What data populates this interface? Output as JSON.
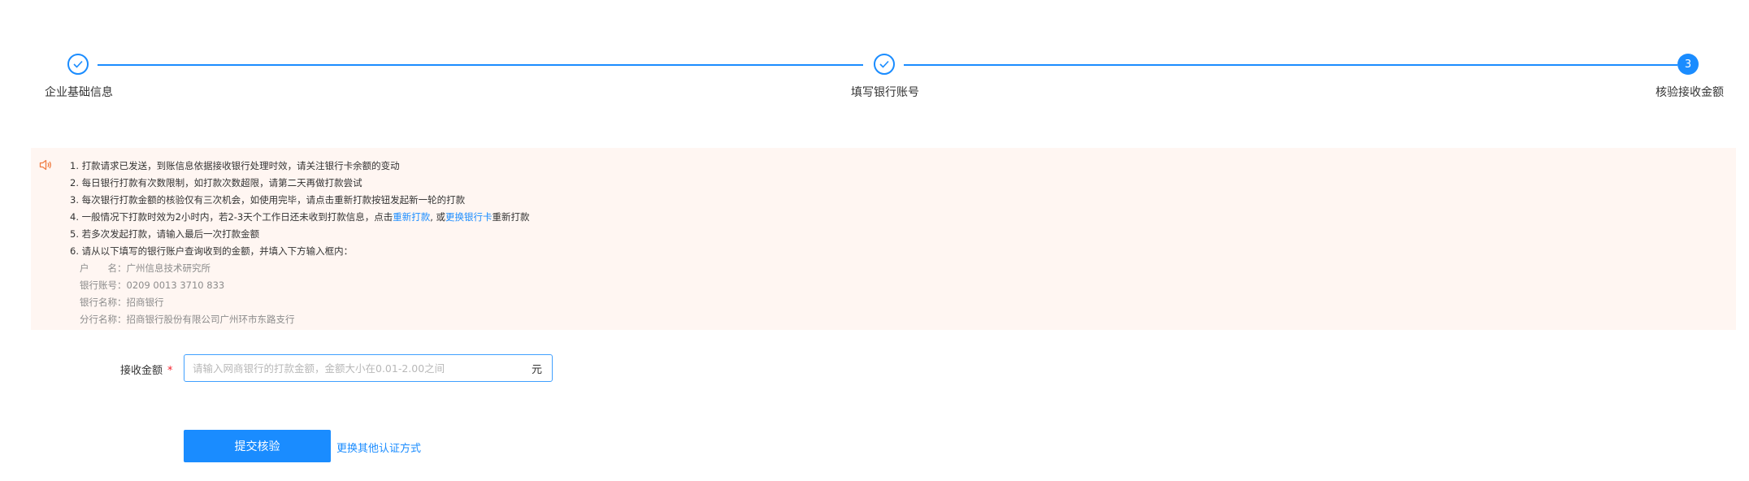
{
  "steps": [
    {
      "label": "企业基础信息",
      "status": "done"
    },
    {
      "label": "填写银行账号",
      "status": "done"
    },
    {
      "label": "核验接收金额",
      "status": "active",
      "number": "3"
    }
  ],
  "notice": {
    "icon": "speaker-icon",
    "items": [
      "1. 打款请求已发送，到账信息依据接收银行处理时效，请关注银行卡余额的变动",
      "2. 每日银行打款有次数限制，如打款次数超限，请第二天再做打款尝试",
      "3. 每次银行打款金额的核验仅有三次机会，如使用完毕，请点击重新打款按钮发起新一轮的打款"
    ],
    "item4": {
      "prefix": "4. 一般情况下打款时效为2小时内，若2-3天个工作日还未收到打款信息，点击",
      "link1": "重新打款",
      "middle": ", 或",
      "link2": "更换银行卡",
      "suffix": "重新打款"
    },
    "item5": "5. 若多次发起打款，请输入最后一次打款金额",
    "item6": "6. 请从以下填写的银行账户查询收到的金额，并填入下方输入框内：",
    "account": {
      "name": "户　　名：广州信息技术研究所",
      "number": "银行账号：0209 0013 3710 833",
      "bank": "银行名称：招商银行",
      "branch": "分行名称：招商银行股份有限公司广州环市东路支行"
    }
  },
  "form": {
    "label": "接收金额",
    "required_mark": "*",
    "placeholder": "请输入网商银行的打款金额，金额大小在0.01-2.00之间",
    "value": "",
    "unit": "元"
  },
  "actions": {
    "submit_label": "提交核验",
    "alt_label": "更换其他认证方式"
  },
  "colors": {
    "primary": "#1a8cff",
    "notice_bg": "#fff6f2",
    "notice_icon": "#f07c42",
    "required": "#f5222d"
  }
}
